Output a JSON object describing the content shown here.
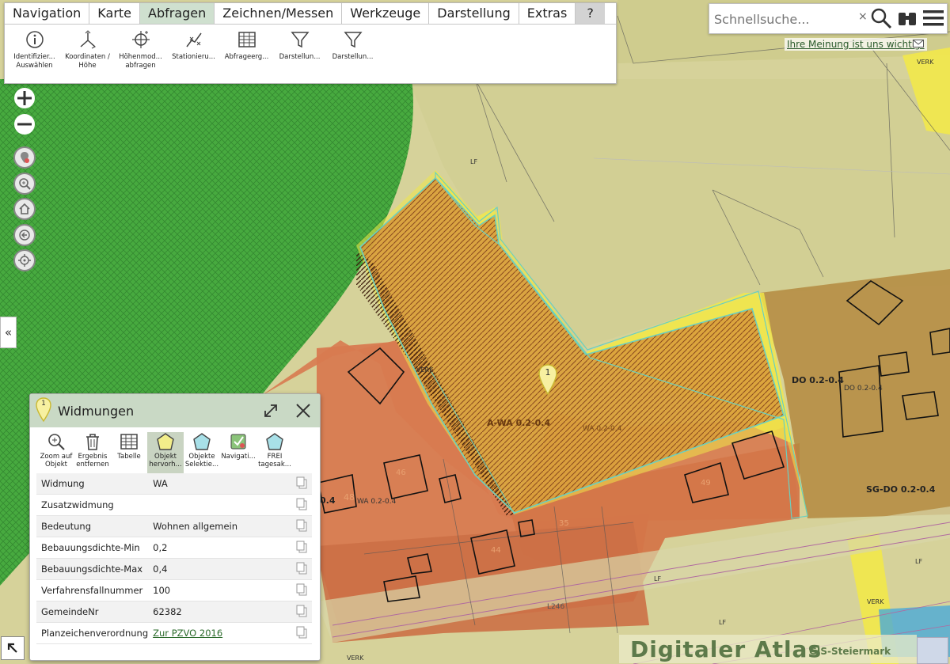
{
  "menu": {
    "tabs": [
      "Navigation",
      "Karte",
      "Abfragen",
      "Zeichnen/Messen",
      "Werkzeuge",
      "Darstellung",
      "Extras",
      "?"
    ],
    "active_tab": "Abfragen",
    "tools": [
      {
        "label": "Identifizier... Auswählen",
        "icon": "info-icon"
      },
      {
        "label": "Koordinaten / Höhe",
        "icon": "coordinates-icon"
      },
      {
        "label": "Höhenmod... abfragen",
        "icon": "elevation-model-icon"
      },
      {
        "label": "Stationieru...",
        "icon": "stationing-icon"
      },
      {
        "label": "Abfrageerg...",
        "icon": "table-icon"
      },
      {
        "label": "Darstellun...",
        "icon": "filter-icon"
      },
      {
        "label": "Darstellun...",
        "icon": "filter-icon"
      }
    ]
  },
  "search": {
    "placeholder": "Schnellsuche...",
    "clear": "×"
  },
  "feedback": "Ihre Meinung ist uns wichtig!",
  "collapse": "«",
  "map_labels": {
    "zone_main": "A-WA 0.2-0.4",
    "zone_main_small": "WA 0.2-0.4",
    "zone_do": "DO 0.2-0.4",
    "zone_do_small": "DO 0.2-0.4",
    "zone_sg": "SG-DO 0.2-0.4",
    "zone_left": "0.4",
    "zone_left_48": "48",
    "zone_left_small": "WA 0.2-0.4",
    "lf1": "LF",
    "lf2": "LF",
    "lf3": "LF",
    "lf4": "LF",
    "verk1": "VERK",
    "verk2": "VERK",
    "verk3": "VERK",
    "verk4": "VERK",
    "road": "L246",
    "parcel_46": "46",
    "parcel_49": "49",
    "parcel_35": "35",
    "parcel_44": "44",
    "marker": "1"
  },
  "panel": {
    "marker": "1",
    "title": "Widmungen",
    "tools": [
      {
        "label": "Zoom auf Objekt",
        "icon": "zoom-icon"
      },
      {
        "label": "Ergebnis entfernen",
        "icon": "trash-icon"
      },
      {
        "label": "Tabelle",
        "icon": "table-icon"
      },
      {
        "label": "Objekt hervorh...",
        "icon": "highlight-object-icon"
      },
      {
        "label": "Objekte Selektie...",
        "icon": "select-objects-icon"
      },
      {
        "label": "Navigati...",
        "icon": "navigation-icon"
      },
      {
        "label": "FREI tagesak...",
        "icon": "free-object-icon"
      }
    ],
    "rows": [
      {
        "label": "Widmung",
        "value": "WA"
      },
      {
        "label": "Zusatzwidmung",
        "value": ""
      },
      {
        "label": "Bedeutung",
        "value": "Wohnen allgemein"
      },
      {
        "label": "Bebauungsdichte-Min",
        "value": "0,2"
      },
      {
        "label": "Bebauungsdichte-Max",
        "value": "0,4"
      },
      {
        "label": "Verfahrensfallnummer",
        "value": "100"
      },
      {
        "label": "GemeindeNr",
        "value": "62382"
      },
      {
        "label": "Planzeichenverordnung",
        "value": "Zur PZVO 2016"
      }
    ]
  },
  "brand": {
    "main": "Digitaler Atlas",
    "sub": "GIS-Steiermark"
  },
  "colors": {
    "accent": "#c9d9c5",
    "forest": "#3fa83a",
    "residential": "#d87a50",
    "highlight": "#f2e84a"
  }
}
